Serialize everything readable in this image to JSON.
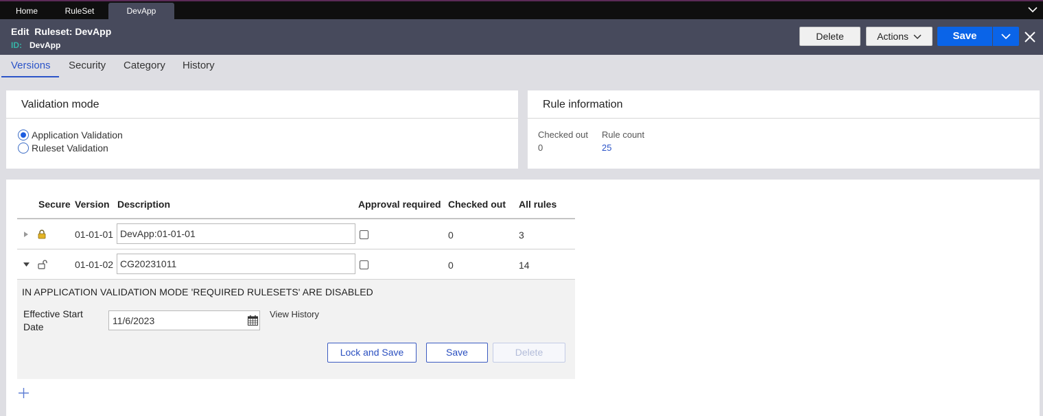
{
  "top_tabs": [
    {
      "label": "Home"
    },
    {
      "label": "RuleSet"
    },
    {
      "label": "DevApp"
    }
  ],
  "header": {
    "title": "Edit  Ruleset: DevApp",
    "id_label": "ID:",
    "id_value": "DevApp",
    "delete_label": "Delete",
    "actions_label": "Actions",
    "save_label": "Save"
  },
  "sub_tabs": [
    {
      "label": "Versions"
    },
    {
      "label": "Security"
    },
    {
      "label": "Category"
    },
    {
      "label": "History"
    }
  ],
  "validation": {
    "title": "Validation mode",
    "options": [
      {
        "label": "Application Validation",
        "selected": true
      },
      {
        "label": "Ruleset Validation",
        "selected": false
      }
    ]
  },
  "rule_info": {
    "title": "Rule information",
    "checked_out_label": "Checked out",
    "checked_out_value": "0",
    "rule_count_label": "Rule count",
    "rule_count_value": "25"
  },
  "versions": {
    "columns": [
      "Secure",
      "Version",
      "Description",
      "Approval required",
      "Checked out",
      "All rules"
    ],
    "rows": [
      {
        "version": "01-01-01",
        "description": "DevApp:01-01-01",
        "approval_required": false,
        "checked_out": "0",
        "all_rules": "3",
        "locked": true,
        "expanded": false
      },
      {
        "version": "01-01-02",
        "description": "CG20231011",
        "approval_required": false,
        "checked_out": "0",
        "all_rules": "14",
        "locked": false,
        "expanded": true
      }
    ],
    "expanded_panel": {
      "warning": "IN APPLICATION VALIDATION MODE 'REQUIRED RULESETS' ARE DISABLED",
      "effective_start_label_1": "Effective Start",
      "effective_start_label_2": "Date",
      "effective_start_value": "11/6/2023",
      "view_history_label": "View History",
      "lock_save_label": "Lock and Save",
      "save_label": "Save",
      "delete_label": "Delete"
    }
  },
  "colors": {
    "accent": "#0a64e8",
    "link": "#2a53c8",
    "header_bg": "#474a5c"
  }
}
